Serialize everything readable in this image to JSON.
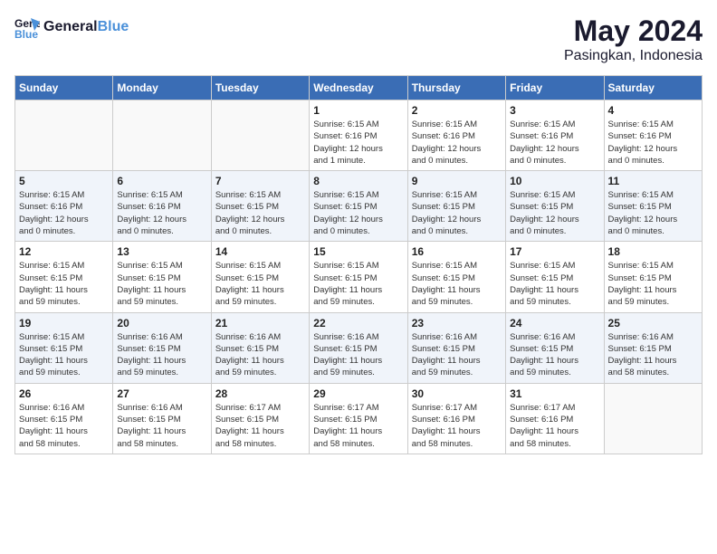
{
  "header": {
    "logo_line1": "General",
    "logo_line2": "Blue",
    "month_year": "May 2024",
    "location": "Pasingkan, Indonesia"
  },
  "weekdays": [
    "Sunday",
    "Monday",
    "Tuesday",
    "Wednesday",
    "Thursday",
    "Friday",
    "Saturday"
  ],
  "weeks": [
    [
      {
        "day": "",
        "info": ""
      },
      {
        "day": "",
        "info": ""
      },
      {
        "day": "",
        "info": ""
      },
      {
        "day": "1",
        "info": "Sunrise: 6:15 AM\nSunset: 6:16 PM\nDaylight: 12 hours\nand 1 minute."
      },
      {
        "day": "2",
        "info": "Sunrise: 6:15 AM\nSunset: 6:16 PM\nDaylight: 12 hours\nand 0 minutes."
      },
      {
        "day": "3",
        "info": "Sunrise: 6:15 AM\nSunset: 6:16 PM\nDaylight: 12 hours\nand 0 minutes."
      },
      {
        "day": "4",
        "info": "Sunrise: 6:15 AM\nSunset: 6:16 PM\nDaylight: 12 hours\nand 0 minutes."
      }
    ],
    [
      {
        "day": "5",
        "info": "Sunrise: 6:15 AM\nSunset: 6:16 PM\nDaylight: 12 hours\nand 0 minutes."
      },
      {
        "day": "6",
        "info": "Sunrise: 6:15 AM\nSunset: 6:16 PM\nDaylight: 12 hours\nand 0 minutes."
      },
      {
        "day": "7",
        "info": "Sunrise: 6:15 AM\nSunset: 6:15 PM\nDaylight: 12 hours\nand 0 minutes."
      },
      {
        "day": "8",
        "info": "Sunrise: 6:15 AM\nSunset: 6:15 PM\nDaylight: 12 hours\nand 0 minutes."
      },
      {
        "day": "9",
        "info": "Sunrise: 6:15 AM\nSunset: 6:15 PM\nDaylight: 12 hours\nand 0 minutes."
      },
      {
        "day": "10",
        "info": "Sunrise: 6:15 AM\nSunset: 6:15 PM\nDaylight: 12 hours\nand 0 minutes."
      },
      {
        "day": "11",
        "info": "Sunrise: 6:15 AM\nSunset: 6:15 PM\nDaylight: 12 hours\nand 0 minutes."
      }
    ],
    [
      {
        "day": "12",
        "info": "Sunrise: 6:15 AM\nSunset: 6:15 PM\nDaylight: 11 hours\nand 59 minutes."
      },
      {
        "day": "13",
        "info": "Sunrise: 6:15 AM\nSunset: 6:15 PM\nDaylight: 11 hours\nand 59 minutes."
      },
      {
        "day": "14",
        "info": "Sunrise: 6:15 AM\nSunset: 6:15 PM\nDaylight: 11 hours\nand 59 minutes."
      },
      {
        "day": "15",
        "info": "Sunrise: 6:15 AM\nSunset: 6:15 PM\nDaylight: 11 hours\nand 59 minutes."
      },
      {
        "day": "16",
        "info": "Sunrise: 6:15 AM\nSunset: 6:15 PM\nDaylight: 11 hours\nand 59 minutes."
      },
      {
        "day": "17",
        "info": "Sunrise: 6:15 AM\nSunset: 6:15 PM\nDaylight: 11 hours\nand 59 minutes."
      },
      {
        "day": "18",
        "info": "Sunrise: 6:15 AM\nSunset: 6:15 PM\nDaylight: 11 hours\nand 59 minutes."
      }
    ],
    [
      {
        "day": "19",
        "info": "Sunrise: 6:15 AM\nSunset: 6:15 PM\nDaylight: 11 hours\nand 59 minutes."
      },
      {
        "day": "20",
        "info": "Sunrise: 6:16 AM\nSunset: 6:15 PM\nDaylight: 11 hours\nand 59 minutes."
      },
      {
        "day": "21",
        "info": "Sunrise: 6:16 AM\nSunset: 6:15 PM\nDaylight: 11 hours\nand 59 minutes."
      },
      {
        "day": "22",
        "info": "Sunrise: 6:16 AM\nSunset: 6:15 PM\nDaylight: 11 hours\nand 59 minutes."
      },
      {
        "day": "23",
        "info": "Sunrise: 6:16 AM\nSunset: 6:15 PM\nDaylight: 11 hours\nand 59 minutes."
      },
      {
        "day": "24",
        "info": "Sunrise: 6:16 AM\nSunset: 6:15 PM\nDaylight: 11 hours\nand 59 minutes."
      },
      {
        "day": "25",
        "info": "Sunrise: 6:16 AM\nSunset: 6:15 PM\nDaylight: 11 hours\nand 58 minutes."
      }
    ],
    [
      {
        "day": "26",
        "info": "Sunrise: 6:16 AM\nSunset: 6:15 PM\nDaylight: 11 hours\nand 58 minutes."
      },
      {
        "day": "27",
        "info": "Sunrise: 6:16 AM\nSunset: 6:15 PM\nDaylight: 11 hours\nand 58 minutes."
      },
      {
        "day": "28",
        "info": "Sunrise: 6:17 AM\nSunset: 6:15 PM\nDaylight: 11 hours\nand 58 minutes."
      },
      {
        "day": "29",
        "info": "Sunrise: 6:17 AM\nSunset: 6:15 PM\nDaylight: 11 hours\nand 58 minutes."
      },
      {
        "day": "30",
        "info": "Sunrise: 6:17 AM\nSunset: 6:16 PM\nDaylight: 11 hours\nand 58 minutes."
      },
      {
        "day": "31",
        "info": "Sunrise: 6:17 AM\nSunset: 6:16 PM\nDaylight: 11 hours\nand 58 minutes."
      },
      {
        "day": "",
        "info": ""
      }
    ]
  ]
}
